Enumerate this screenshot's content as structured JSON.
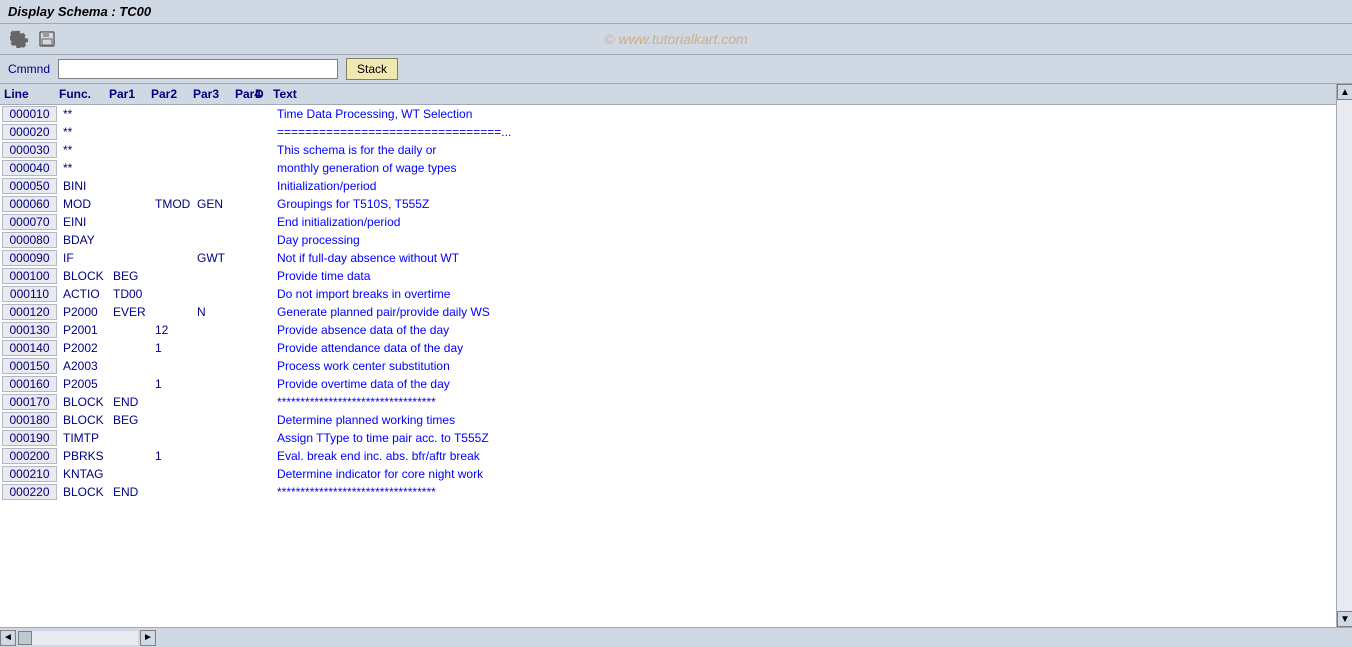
{
  "title": "Display Schema : TC00",
  "watermark": "© www.tutorialkart.com",
  "toolbar": {
    "icons": [
      {
        "name": "settings-icon",
        "symbol": "⚙"
      },
      {
        "name": "save-icon",
        "symbol": "💾"
      }
    ]
  },
  "command_bar": {
    "label": "Cmmnd",
    "input_value": "",
    "stack_button": "Stack"
  },
  "columns": {
    "line": "Line",
    "func": "Func.",
    "par1": "Par1",
    "par2": "Par2",
    "par3": "Par3",
    "par4": "Par4",
    "d": "D",
    "text": "Text"
  },
  "rows": [
    {
      "line": "000010",
      "func": "**",
      "par1": "",
      "par2": "",
      "par3": "",
      "par4": "",
      "d": "",
      "text": "Time Data Processing, WT Selection"
    },
    {
      "line": "000020",
      "func": "**",
      "par1": "",
      "par2": "",
      "par3": "",
      "par4": "",
      "d": "",
      "text": "================================..."
    },
    {
      "line": "000030",
      "func": "**",
      "par1": "",
      "par2": "",
      "par3": "",
      "par4": "",
      "d": "",
      "text": "This schema is for the daily or"
    },
    {
      "line": "000040",
      "func": "**",
      "par1": "",
      "par2": "",
      "par3": "",
      "par4": "",
      "d": "",
      "text": "monthly generation of wage types"
    },
    {
      "line": "000050",
      "func": "BINI",
      "par1": "",
      "par2": "",
      "par3": "",
      "par4": "",
      "d": "",
      "text": "Initialization/period"
    },
    {
      "line": "000060",
      "func": "MOD",
      "par1": "",
      "par2": "TMOD",
      "par3": "GEN",
      "par4": "",
      "d": "",
      "text": "Groupings for T510S, T555Z"
    },
    {
      "line": "000070",
      "func": "EINI",
      "par1": "",
      "par2": "",
      "par3": "",
      "par4": "",
      "d": "",
      "text": "End initialization/period"
    },
    {
      "line": "000080",
      "func": "BDAY",
      "par1": "",
      "par2": "",
      "par3": "",
      "par4": "",
      "d": "",
      "text": "Day processing"
    },
    {
      "line": "000090",
      "func": "IF",
      "par1": "",
      "par2": "",
      "par3": "GWT",
      "par4": "",
      "d": "",
      "text": "Not if full-day absence without WT"
    },
    {
      "line": "000100",
      "func": "BLOCK",
      "par1": "BEG",
      "par2": "",
      "par3": "",
      "par4": "",
      "d": "",
      "text": "Provide time data"
    },
    {
      "line": "000110",
      "func": "ACTIO",
      "par1": "TD00",
      "par2": "",
      "par3": "",
      "par4": "",
      "d": "",
      "text": "Do not import breaks in overtime"
    },
    {
      "line": "000120",
      "func": "P2000",
      "par1": "EVER",
      "par2": "",
      "par3": "N",
      "par4": "",
      "d": "",
      "text": "Generate planned pair/provide daily WS"
    },
    {
      "line": "000130",
      "func": "P2001",
      "par1": "",
      "par2": "12",
      "par3": "",
      "par4": "",
      "d": "",
      "text": "Provide absence data of the day"
    },
    {
      "line": "000140",
      "func": "P2002",
      "par1": "",
      "par2": "1",
      "par3": "",
      "par4": "",
      "d": "",
      "text": "Provide attendance data of the day"
    },
    {
      "line": "000150",
      "func": "A2003",
      "par1": "",
      "par2": "",
      "par3": "",
      "par4": "",
      "d": "",
      "text": "Process work center substitution"
    },
    {
      "line": "000160",
      "func": "P2005",
      "par1": "",
      "par2": "1",
      "par3": "",
      "par4": "",
      "d": "",
      "text": "Provide overtime data of the day"
    },
    {
      "line": "000170",
      "func": "BLOCK",
      "par1": "END",
      "par2": "",
      "par3": "",
      "par4": "",
      "d": "",
      "text": "**********************************"
    },
    {
      "line": "000180",
      "func": "BLOCK",
      "par1": "BEG",
      "par2": "",
      "par3": "",
      "par4": "",
      "d": "",
      "text": "Determine planned working times"
    },
    {
      "line": "000190",
      "func": "TIMTP",
      "par1": "",
      "par2": "",
      "par3": "",
      "par4": "",
      "d": "",
      "text": "Assign TType to time pair acc. to T555Z"
    },
    {
      "line": "000200",
      "func": "PBRKS",
      "par1": "",
      "par2": "1",
      "par3": "",
      "par4": "",
      "d": "",
      "text": "Eval. break end inc. abs. bfr/aftr break"
    },
    {
      "line": "000210",
      "func": "KNTAG",
      "par1": "",
      "par2": "",
      "par3": "",
      "par4": "",
      "d": "",
      "text": "Determine indicator for core night work"
    },
    {
      "line": "000220",
      "func": "BLOCK",
      "par1": "END",
      "par2": "",
      "par3": "",
      "par4": "",
      "d": "",
      "text": "**********************************"
    }
  ]
}
